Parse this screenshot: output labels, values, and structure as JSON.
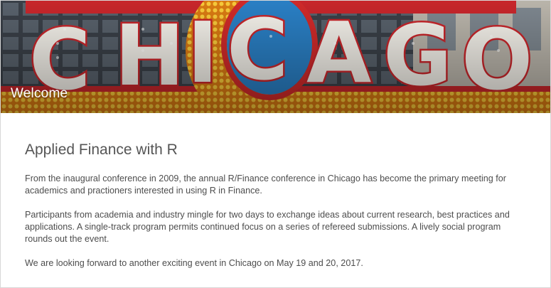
{
  "hero": {
    "sign_letters": [
      "C",
      "H",
      "I",
      "C",
      "A",
      "G",
      "O"
    ],
    "heading": "Welcome",
    "colors": {
      "sign_red": "#cf2a2a",
      "sign_blue": "#2a7fc4",
      "bulb_gold": "#f1b11e",
      "letter_white": "#f4f1ea",
      "building_dark": "#2a2f36"
    }
  },
  "main": {
    "title": "Applied Finance with R",
    "paragraphs": [
      "From the inaugural conference in 2009, the annual R/Finance conference in Chicago has become the primary meeting for academics and practioners interested in using R in Finance.",
      "Participants from academia and industry mingle for two days to exchange ideas about current research, best practices and applications. A single-track program permits continued focus on a series of refereed submissions. A lively social program rounds out the event.",
      "We are looking forward to another exciting event in Chicago on May 19 and 20, 2017."
    ]
  }
}
